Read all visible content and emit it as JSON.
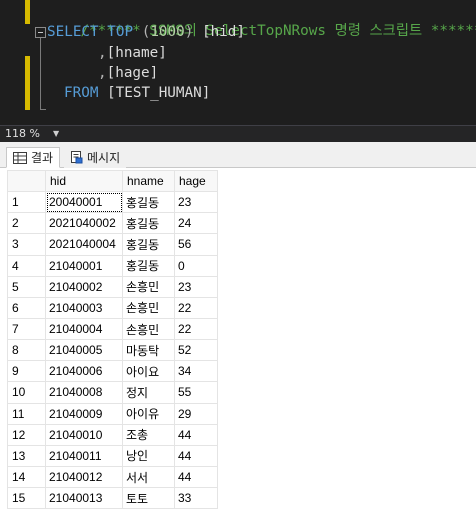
{
  "editor": {
    "lines": [
      {
        "comment": "/****** SSMS의 SelectTopNRows 명령 스크립트 ******/"
      },
      {
        "kw1": "SELECT",
        "kw2": "TOP",
        "open": "(",
        "num": "1000",
        "close": ")",
        "col": "[hid]"
      },
      {
        "comma": ",",
        "col": "[hname]"
      },
      {
        "comma": ",",
        "col": "[hage]"
      },
      {
        "kw": "FROM",
        "table": "[TEST_HUMAN]"
      }
    ]
  },
  "status": {
    "zoom": "118 %"
  },
  "tabs": [
    {
      "label": "결과",
      "icon": "grid-icon"
    },
    {
      "label": "메시지",
      "icon": "message-icon"
    }
  ],
  "results": {
    "columns": [
      "hid",
      "hname",
      "hage"
    ],
    "rows": [
      [
        "1",
        "20040001",
        "홍길동",
        "23"
      ],
      [
        "2",
        "2021040002",
        "홍길동",
        "24"
      ],
      [
        "3",
        "2021040004",
        "홍길동",
        "56"
      ],
      [
        "4",
        "21040001",
        "홍길동",
        "0"
      ],
      [
        "5",
        "21040002",
        "손흥민",
        "23"
      ],
      [
        "6",
        "21040003",
        "손흥민",
        "22"
      ],
      [
        "7",
        "21040004",
        "손흥민",
        "22"
      ],
      [
        "8",
        "21040005",
        "마동탁",
        "52"
      ],
      [
        "9",
        "21040006",
        "아이요",
        "34"
      ],
      [
        "10",
        "21040008",
        "정지",
        "55"
      ],
      [
        "11",
        "21040009",
        "아이유",
        "29"
      ],
      [
        "12",
        "21040010",
        "조총",
        "44"
      ],
      [
        "13",
        "21040011",
        "낭인",
        "44"
      ],
      [
        "14",
        "21040012",
        "서서",
        "44"
      ],
      [
        "15",
        "21040013",
        "토토",
        "33"
      ]
    ]
  }
}
